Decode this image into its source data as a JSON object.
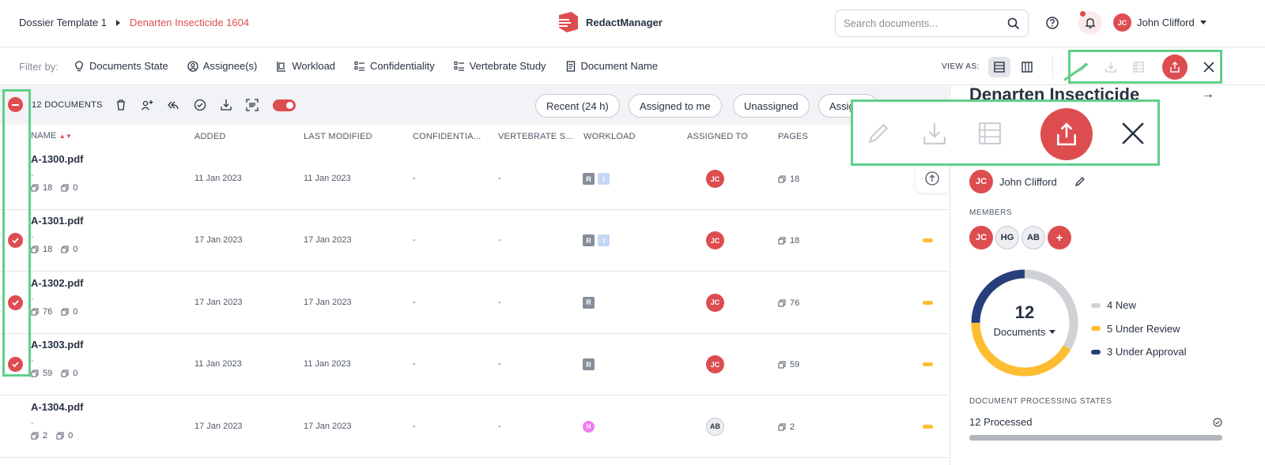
{
  "breadcrumb": {
    "template": "Dossier Template 1",
    "dossier": "Denarten Insecticide 1604"
  },
  "brand": {
    "name": "RedactManager"
  },
  "search": {
    "placeholder": "Search documents..."
  },
  "user": {
    "initials": "JC",
    "name": "John Clifford"
  },
  "filterbar": {
    "label": "Filter by:",
    "filters": [
      "Documents State",
      "Assignee(s)",
      "Workload",
      "Confidentiality",
      "Vertebrate Study",
      "Document Name"
    ],
    "view_as": "VIEW AS:"
  },
  "toolbar": {
    "count": "12 DOCUMENTS",
    "chips": [
      "Recent (24 h)",
      "Assigned to me",
      "Unassigned",
      "Assig"
    ]
  },
  "columns": [
    "NAME",
    "ADDED",
    "LAST MODIFIED",
    "CONFIDENTIA...",
    "VERTEBRATE S...",
    "WORKLOAD",
    "ASSIGNED TO",
    "PAGES"
  ],
  "rows": [
    {
      "name": "A-1300.pdf",
      "sub": "-",
      "pages": "18",
      "annotations": "0",
      "added": "11 Jan 2023",
      "modified": "11 Jan 2023",
      "conf": "-",
      "vert": "-",
      "workload": [
        "R",
        "I"
      ],
      "assignee": "JC",
      "page_count": "18",
      "checked": false,
      "status": false
    },
    {
      "name": "A-1301.pdf",
      "sub": "-",
      "pages": "18",
      "annotations": "0",
      "added": "17 Jan 2023",
      "modified": "17 Jan 2023",
      "conf": "-",
      "vert": "-",
      "workload": [
        "R",
        "I"
      ],
      "assignee": "JC",
      "page_count": "18",
      "checked": true,
      "status": true
    },
    {
      "name": "A-1302.pdf",
      "sub": "-",
      "pages": "76",
      "annotations": "0",
      "added": "17 Jan 2023",
      "modified": "17 Jan 2023",
      "conf": "-",
      "vert": "-",
      "workload": [
        "R"
      ],
      "assignee": "JC",
      "page_count": "76",
      "checked": true,
      "status": true
    },
    {
      "name": "A-1303.pdf",
      "sub": "-",
      "pages": "59",
      "annotations": "0",
      "added": "11 Jan 2023",
      "modified": "11 Jan 2023",
      "conf": "-",
      "vert": "-",
      "workload": [
        "R"
      ],
      "assignee": "JC",
      "page_count": "59",
      "checked": true,
      "status": true
    },
    {
      "name": "A-1304.pdf",
      "sub": "-",
      "pages": "2",
      "annotations": "0",
      "added": "17 Jan 2023",
      "modified": "17 Jan 2023",
      "conf": "-",
      "vert": "-",
      "workload": [
        "H"
      ],
      "assignee": "AB",
      "page_count": "2",
      "checked": false,
      "status": true
    }
  ],
  "panel": {
    "title": "Denarten Insecticide",
    "owner": {
      "initials": "JC",
      "name": "John Clifford"
    },
    "members_label": "MEMBERS",
    "members": [
      "JC",
      "HG",
      "AB",
      "+"
    ],
    "donut": {
      "total": "12",
      "label": "Documents",
      "legend": [
        {
          "label": "4 New",
          "value": 4,
          "color": "#cfd1d6"
        },
        {
          "label": "5 Under Review",
          "value": 5,
          "color": "#fdbd31"
        },
        {
          "label": "3 Under Approval",
          "value": 3,
          "color": "#283f7b"
        }
      ]
    },
    "processing_label": "DOCUMENT PROCESSING STATES",
    "processed": "12 Processed",
    "processed_fraction": 1.0
  },
  "colors": {
    "accent": "#dd4d50",
    "highlight": "#5fd08a"
  }
}
